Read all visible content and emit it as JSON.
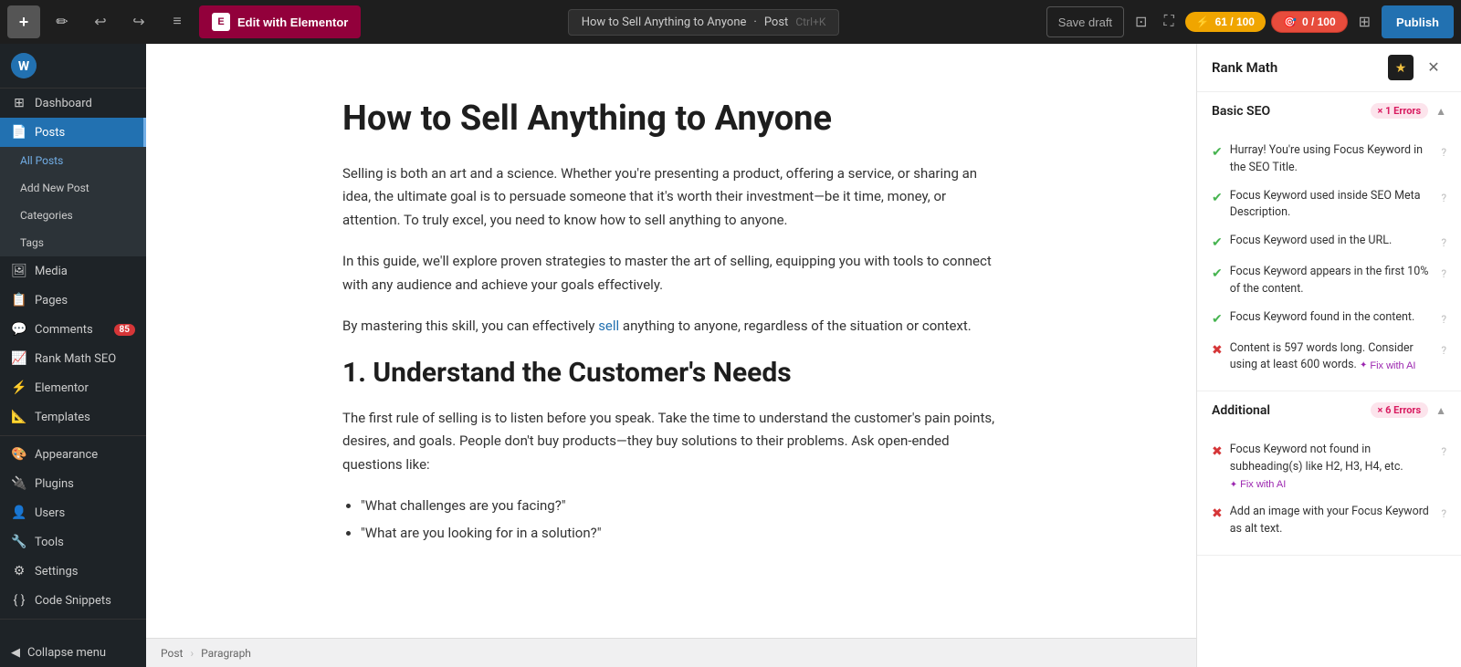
{
  "toolbar": {
    "add_icon": "+",
    "edit_icon": "✏",
    "undo_icon": "↩",
    "redo_icon": "↪",
    "list_icon": "≡",
    "elementor_label": "Edit with Elementor",
    "elementor_icon_text": "E",
    "post_title": "How to Sell Anything to Anyone",
    "post_type": "Post",
    "shortcut": "Ctrl+K",
    "save_draft": "Save draft",
    "score_green_label": "61 / 100",
    "score_red_label": "0 / 100",
    "publish_label": "Publish"
  },
  "sidebar": {
    "logo_text": "WordPress",
    "items": [
      {
        "id": "dashboard",
        "label": "Dashboard",
        "icon": "⊞"
      },
      {
        "id": "posts",
        "label": "Posts",
        "icon": "📄",
        "active": true
      },
      {
        "id": "all-posts",
        "label": "All Posts",
        "sub": true,
        "active_sub": true
      },
      {
        "id": "add-new-post",
        "label": "Add New Post",
        "sub": true
      },
      {
        "id": "categories",
        "label": "Categories",
        "sub": true
      },
      {
        "id": "tags",
        "label": "Tags",
        "sub": true
      },
      {
        "id": "media",
        "label": "Media",
        "icon": "🖼"
      },
      {
        "id": "pages",
        "label": "Pages",
        "icon": "📋"
      },
      {
        "id": "comments",
        "label": "Comments",
        "icon": "💬",
        "badge": "85"
      },
      {
        "id": "rankmath",
        "label": "Rank Math SEO",
        "icon": "📈"
      },
      {
        "id": "elementor",
        "label": "Elementor",
        "icon": "⚡"
      },
      {
        "id": "templates",
        "label": "Templates",
        "icon": "📐"
      },
      {
        "id": "appearance",
        "label": "Appearance",
        "icon": "🎨"
      },
      {
        "id": "plugins",
        "label": "Plugins",
        "icon": "🔌"
      },
      {
        "id": "users",
        "label": "Users",
        "icon": "👤"
      },
      {
        "id": "tools",
        "label": "Tools",
        "icon": "🔧"
      },
      {
        "id": "settings",
        "label": "Settings",
        "icon": "⚙"
      },
      {
        "id": "codesnippets",
        "label": "Code Snippets",
        "icon": "{ }"
      }
    ],
    "collapse": "Collapse menu"
  },
  "editor": {
    "post_title": "How to Sell Anything to Anyone",
    "para1": "Selling is both an art and a science. Whether you're presenting a product, offering a service, or sharing an idea, the ultimate goal is to persuade someone that it's worth their investment—be it time, money, or attention. To truly excel, you need to know how to sell anything to anyone.",
    "para2": "In this guide, we'll explore proven strategies to master the art of selling, equipping you with tools to connect with any audience and achieve your goals effectively.",
    "para3": "By mastering this skill, you can effectively sell anything to anyone, regardless of the situation or context.",
    "h2": "1. Understand the Customer's Needs",
    "para4": "The first rule of selling is to listen before you speak. Take the time to understand the customer's pain points, desires, and goals. People don't buy products—they buy solutions to their problems. Ask open-ended questions like:",
    "list_items": [
      "\"What challenges are you facing?\"",
      "\"What are you looking for in a solution?\""
    ]
  },
  "statusbar": {
    "post": "Post",
    "separator": "›",
    "block": "Paragraph"
  },
  "rankmath": {
    "title": "Rank Math",
    "close_icon": "✕",
    "star_icon": "★",
    "basic_seo_label": "Basic SEO",
    "basic_seo_badge": "× 1 Errors",
    "basic_seo_items": [
      {
        "status": "green",
        "text": "Hurray! You're using Focus Keyword in the SEO Title.",
        "has_help": true
      },
      {
        "status": "green",
        "text": "Focus Keyword used inside SEO Meta Description.",
        "has_help": true
      },
      {
        "status": "green",
        "text": "Focus Keyword used in the URL.",
        "has_help": true
      },
      {
        "status": "green",
        "text": "Focus Keyword appears in the first 10% of the content.",
        "has_help": true
      },
      {
        "status": "green",
        "text": "Focus Keyword found in the content.",
        "has_help": true
      },
      {
        "status": "red",
        "text": "Content is 597 words long. Consider using at least 600 words.",
        "has_help": true,
        "fix_ai": true
      }
    ],
    "additional_label": "Additional",
    "additional_badge": "× 6 Errors",
    "additional_items": [
      {
        "status": "red",
        "text": "Focus Keyword not found in subheading(s) like H2, H3, H4, etc.",
        "has_help": true,
        "fix_ai": true
      },
      {
        "status": "red",
        "text": "Add an image with your Focus Keyword as alt text.",
        "has_help": true
      }
    ],
    "fix_ai_label": "Fix with AI"
  }
}
